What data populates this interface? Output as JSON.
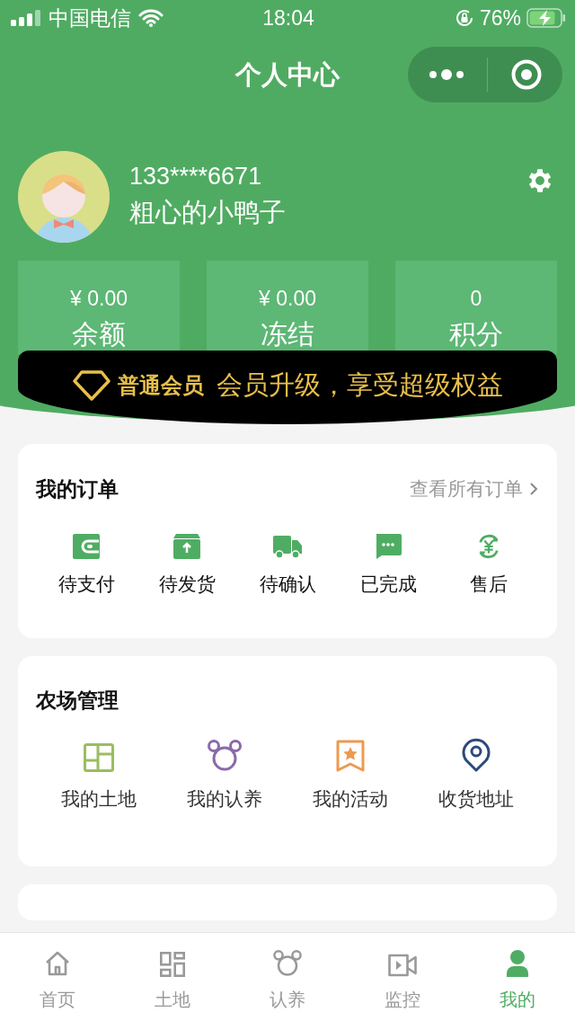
{
  "status_bar": {
    "carrier": "中国电信",
    "time": "18:04",
    "battery": "76%"
  },
  "nav": {
    "title": "个人中心"
  },
  "profile": {
    "phone": "133****6671",
    "nickname": "粗心的小鸭子"
  },
  "stats": [
    {
      "value": "¥ 0.00",
      "label": "余额"
    },
    {
      "value": "¥ 0.00",
      "label": "冻结"
    },
    {
      "value": "0",
      "label": "积分"
    }
  ],
  "membership": {
    "level": "普通会员",
    "slogan": "会员升级，享受超级权益"
  },
  "orders": {
    "title": "我的订单",
    "link": "查看所有订单",
    "items": [
      {
        "kind": "wallet",
        "label": "待支付"
      },
      {
        "kind": "box",
        "label": "待发货"
      },
      {
        "kind": "truck",
        "label": "待确认"
      },
      {
        "kind": "chat",
        "label": "已完成"
      },
      {
        "kind": "refund",
        "label": "售后"
      }
    ]
  },
  "farm": {
    "title": "农场管理",
    "items": [
      {
        "kind": "land",
        "label": "我的土地",
        "color": "#9bbd5f"
      },
      {
        "kind": "bear",
        "label": "我的认养",
        "color": "#8a6aa8"
      },
      {
        "kind": "bookmark",
        "label": "我的活动",
        "color": "#ec9a50"
      },
      {
        "kind": "pin",
        "label": "收货地址",
        "color": "#2c4a7a"
      }
    ]
  },
  "tabs": [
    {
      "kind": "home",
      "label": "首页",
      "selected": false
    },
    {
      "kind": "grid",
      "label": "土地",
      "selected": false
    },
    {
      "kind": "bear",
      "label": "认养",
      "selected": false
    },
    {
      "kind": "video",
      "label": "监控",
      "selected": false
    },
    {
      "kind": "person",
      "label": "我的",
      "selected": true
    }
  ]
}
